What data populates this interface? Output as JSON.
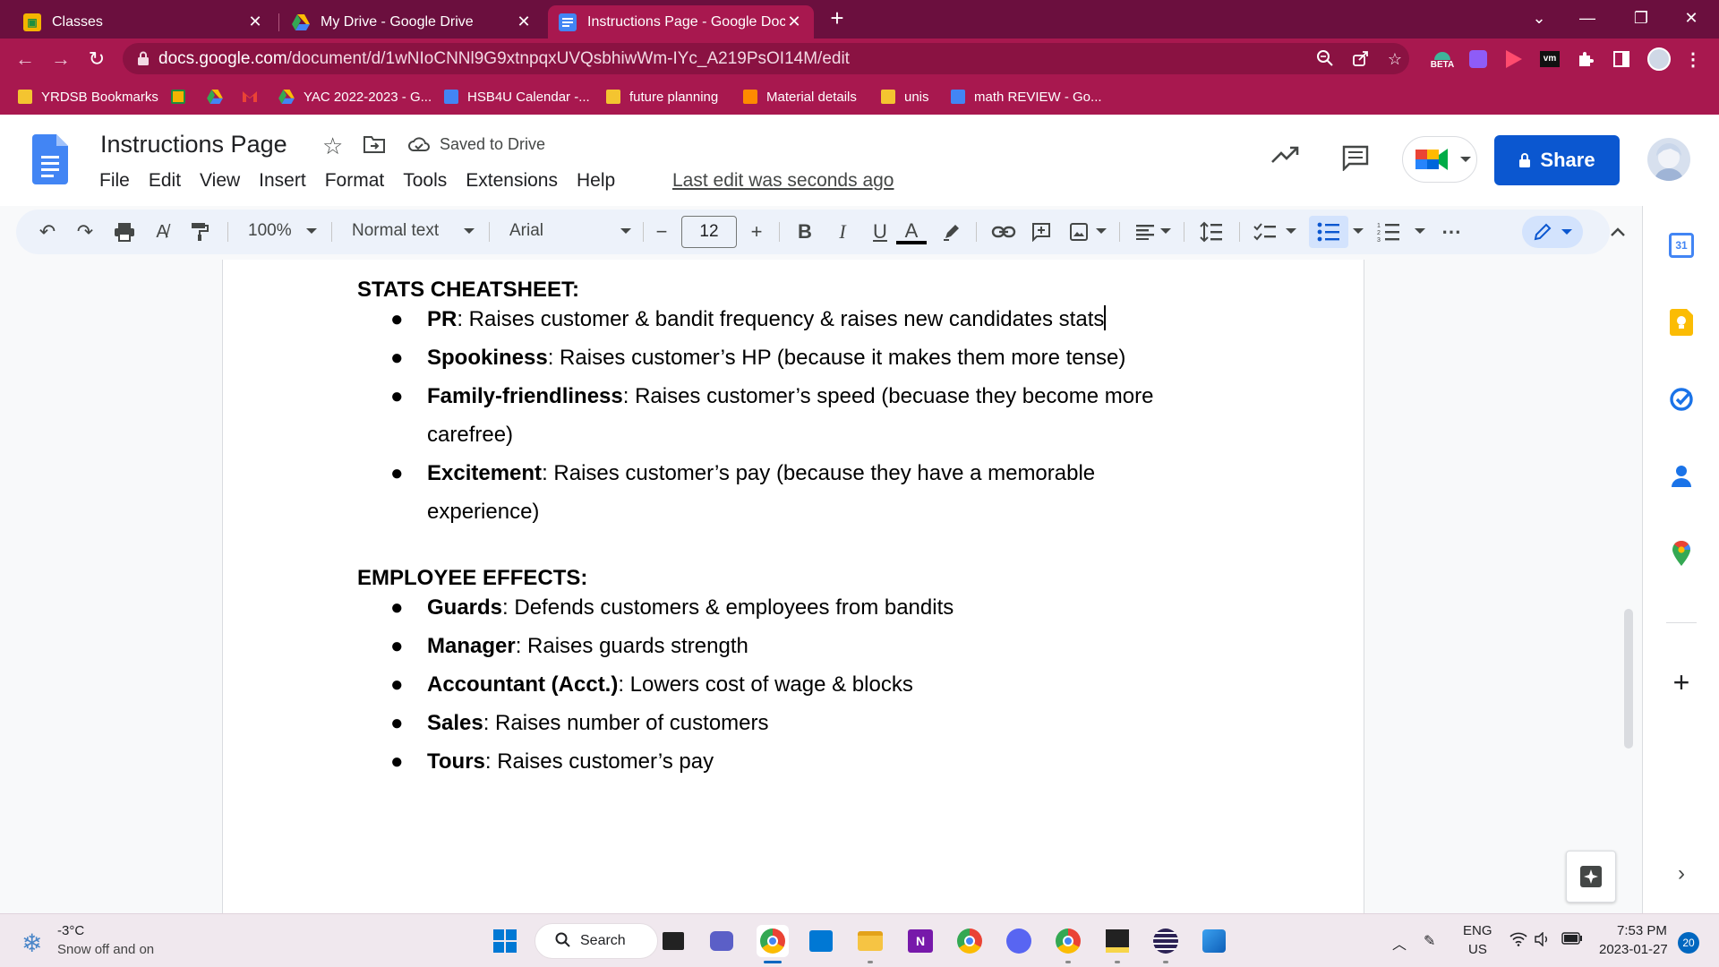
{
  "browser": {
    "tabs": [
      {
        "title": "Classes",
        "favicon": "google-classroom-icon"
      },
      {
        "title": "My Drive - Google Drive",
        "favicon": "google-drive-icon"
      },
      {
        "title": "Instructions Page - Google Docs",
        "favicon": "google-docs-icon",
        "active": true
      }
    ],
    "new_tab_label": "+",
    "url_domain": "docs.google.com",
    "url_path": "/document/d/1wNIoCNNl9G9xtnpqxUVQsbhiwWm-IYc_A219PsOI14M/edit",
    "extension_beta_label": "BETA",
    "bookmarks": [
      {
        "label": "YRDSB Bookmarks",
        "icon": "folder-icon",
        "color": "#f4c430"
      },
      {
        "label": "",
        "icon": "google-classroom-icon",
        "color": "#f4b400"
      },
      {
        "label": "",
        "icon": "google-drive-icon",
        "color": "#34a853"
      },
      {
        "label": "",
        "icon": "gmail-icon",
        "color": "#ea4335"
      },
      {
        "label": "YAC 2022-2023 - G...",
        "icon": "google-drive-icon",
        "color": "#34a853"
      },
      {
        "label": "HSB4U Calendar -...",
        "icon": "google-docs-icon",
        "color": "#4285f4"
      },
      {
        "label": "future planning",
        "icon": "folder-icon",
        "color": "#f4c430"
      },
      {
        "label": "Material details",
        "icon": "sheet-icon",
        "color": "#ff8a00"
      },
      {
        "label": "unis",
        "icon": "folder-icon",
        "color": "#f4c430"
      },
      {
        "label": "math REVIEW - Go...",
        "icon": "google-docs-icon",
        "color": "#4285f4"
      }
    ]
  },
  "docs": {
    "title": "Instructions Page",
    "saved_status": "Saved to Drive",
    "menu": [
      "File",
      "Edit",
      "View",
      "Insert",
      "Format",
      "Tools",
      "Extensions",
      "Help"
    ],
    "last_edit": "Last edit was seconds ago",
    "share_label": "Share",
    "accent_color": "#0b57d0"
  },
  "toolbar": {
    "zoom": "100%",
    "style": "Normal text",
    "font": "Arial",
    "font_size": "12",
    "minus": "−",
    "plus": "+",
    "bold": "B",
    "italic": "I",
    "underline": "U",
    "text_color": "A"
  },
  "document": {
    "heading1": "STATS CHEATSHEET:",
    "stats": [
      {
        "term": "PR",
        "desc": ": Raises customer & bandit frequency & raises new candidates stats"
      },
      {
        "term": "Spookiness",
        "desc": ": Raises customer’s HP (because it makes them more tense)"
      },
      {
        "term": "Family-friendliness",
        "desc": ": Raises customer’s speed (becuase they become more",
        "cont": "carefree)"
      },
      {
        "term": "Excitement",
        "desc": ": Raises customer’s pay (because they have a memorable",
        "cont": "experience)"
      }
    ],
    "heading2": "EMPLOYEE EFFECTS:",
    "employees": [
      {
        "term": "Guards",
        "desc": ": Defends customers & employees from bandits"
      },
      {
        "term": "Manager",
        "desc": ": Raises guards strength"
      },
      {
        "term": "Accountant (Acct.)",
        "desc": ": Lowers cost of wage & blocks"
      },
      {
        "term": "Sales",
        "desc": ": Raises number of customers"
      },
      {
        "term": "Tours",
        "desc": ": Raises customer’s pay"
      }
    ],
    "bullet_char": "●"
  },
  "sidepanel": {
    "calendar_day": "31"
  },
  "taskbar": {
    "weather_temp": "-3°C",
    "weather_desc": "Snow off and on",
    "search_label": "Search",
    "lang_line1": "ENG",
    "lang_line2": "US",
    "time": "7:53 PM",
    "date": "2023-01-27",
    "notifications": "20"
  }
}
